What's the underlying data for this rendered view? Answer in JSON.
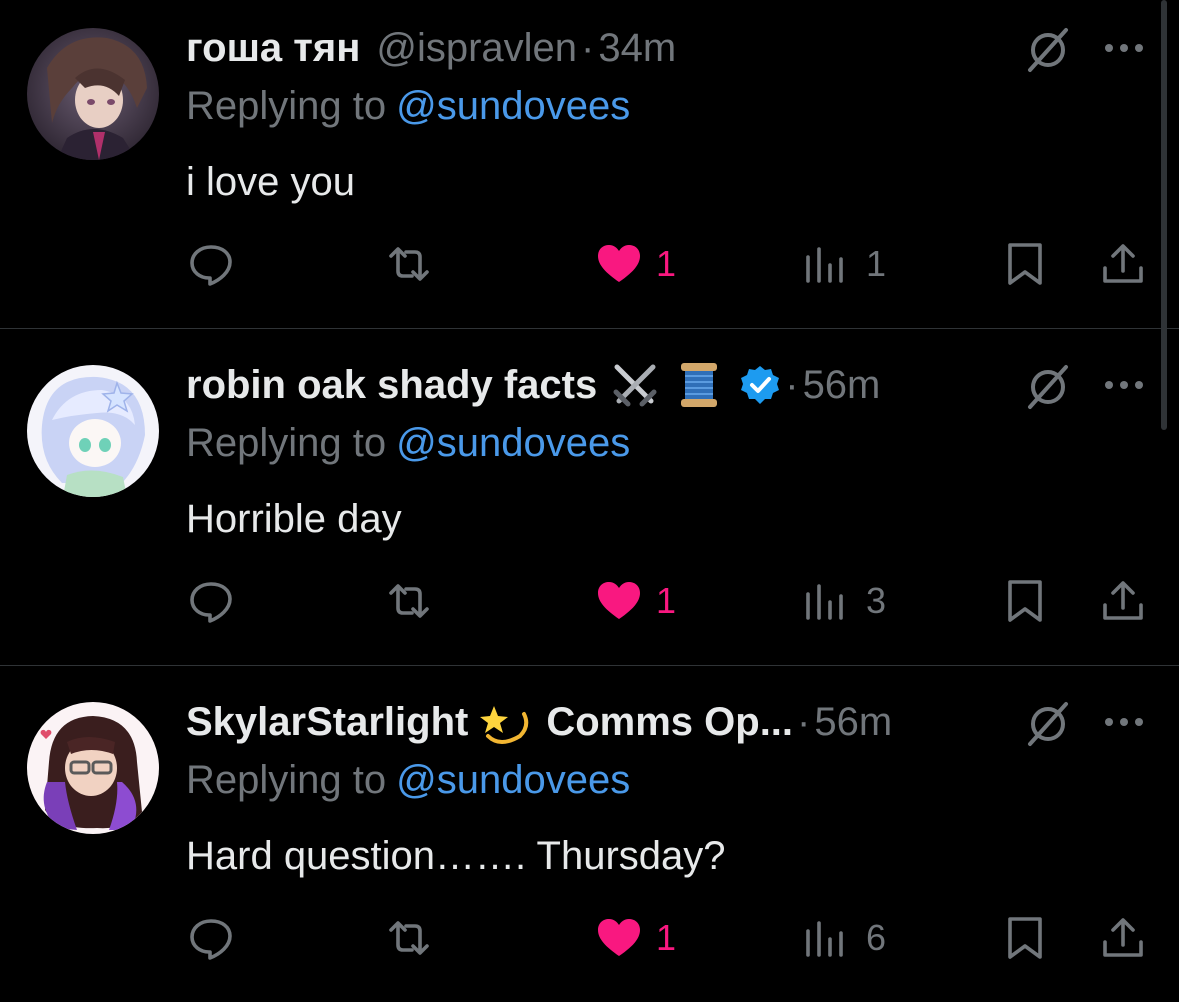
{
  "tweets": [
    {
      "display_name": "гоша тян",
      "handle": "@ispravlen",
      "separator": "·",
      "time": "34m",
      "replying_prefix": "Replying to",
      "replying_to": "@sundovees",
      "text": "i love you",
      "likes": "1",
      "views": "1",
      "name_emojis": [],
      "verified": false
    },
    {
      "display_name": "robin oak shady facts",
      "handle": "",
      "separator": "·",
      "time": "56m",
      "replying_prefix": "Replying to",
      "replying_to": "@sundovees",
      "text": "Horrible day",
      "likes": "1",
      "views": "3",
      "name_emojis": [
        "crossed-swords-icon",
        "thread-spool-icon"
      ],
      "verified": true
    },
    {
      "display_name": "SkylarStarlight",
      "display_name_suffix": "Comms Op...",
      "handle": "",
      "separator": "·",
      "time": "56m",
      "replying_prefix": "Replying to",
      "replying_to": "@sundovees",
      "text": "Hard question……. Thursday?",
      "likes": "1",
      "views": "6",
      "name_emojis": [
        "dizzy-star-icon"
      ],
      "verified": false
    }
  ],
  "colors": {
    "background": "#000000",
    "text_primary": "#e7e9ea",
    "text_secondary": "#71767b",
    "link": "#4a99e9",
    "like": "#f91880",
    "divider": "#2f3336",
    "verified": "#1d9bf0"
  },
  "icons": {
    "reply": "reply-bubble-icon",
    "retweet": "retweet-icon",
    "like": "heart-icon",
    "views": "views-bar-chart-icon",
    "bookmark": "bookmark-icon",
    "share": "share-icon",
    "grok": "grok-slash-icon",
    "more": "more-dots-icon"
  }
}
